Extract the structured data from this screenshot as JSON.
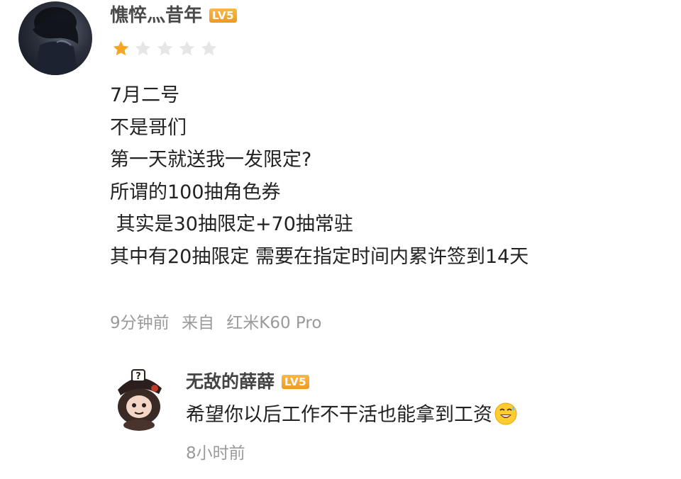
{
  "review": {
    "username": "憔悴灬昔年",
    "level_badge": "LV5",
    "rating": {
      "score": 1,
      "max": 5
    },
    "lines": [
      "7月二号",
      "不是哥们",
      "第一天就送我一发限定?",
      "所谓的100抽角色券",
      " 其实是30抽限定+70抽常驻",
      "其中有20抽限定 需要在指定时间内累许签到14天"
    ],
    "time": "9分钟前",
    "source": "来自",
    "device": "红米K60 Pro"
  },
  "reply": {
    "username": "无敌的薛薛",
    "level_badge": "LV5",
    "text": "希望你以后工作不干活也能拿到工资",
    "emoji": "grinning-sweat-emoji",
    "time": "8小时前"
  },
  "colors": {
    "star_filled": "#f5a623",
    "star_empty": "#e6e6e6",
    "badge": "#f0a02a",
    "meta_text": "#9a9a9a"
  }
}
